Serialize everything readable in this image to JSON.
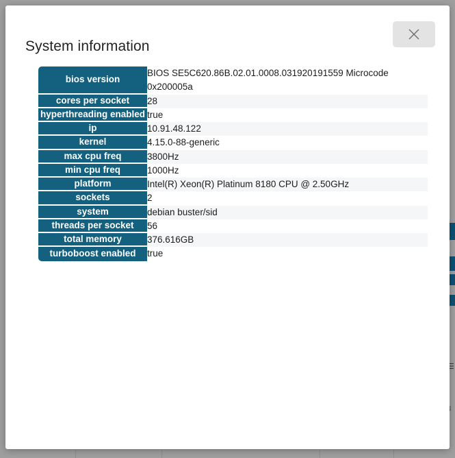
{
  "backdrop": {
    "color": "#9e9e9e",
    "accent_color": "#0d4f74"
  },
  "dialog": {
    "title": "System information",
    "close_button": {
      "label": "Close",
      "icon": "close-icon"
    },
    "accent_color": "#13607f",
    "row_alt_color": "#f5f6f8",
    "rows": [
      {
        "key": "bios version",
        "value": "BIOS SE5C620.86B.02.01.0008.031920191559 Microcode 0x200005a"
      },
      {
        "key": "cores per socket",
        "value": "28"
      },
      {
        "key": "hyperthreading enabled",
        "value": "true"
      },
      {
        "key": "ip",
        "value": "10.91.48.122"
      },
      {
        "key": "kernel",
        "value": "4.15.0-88-generic"
      },
      {
        "key": "max cpu freq",
        "value": "3800Hz"
      },
      {
        "key": "min cpu freq",
        "value": "1000Hz"
      },
      {
        "key": "platform",
        "value": "Intel(R) Xeon(R) Platinum 8180 CPU @ 2.50GHz"
      },
      {
        "key": "sockets",
        "value": "2"
      },
      {
        "key": "system",
        "value": "debian buster/sid"
      },
      {
        "key": "threads per socket",
        "value": "56"
      },
      {
        "key": "total memory",
        "value": "376.616GB"
      },
      {
        "key": "turboboost enabled",
        "value": "true"
      }
    ]
  }
}
